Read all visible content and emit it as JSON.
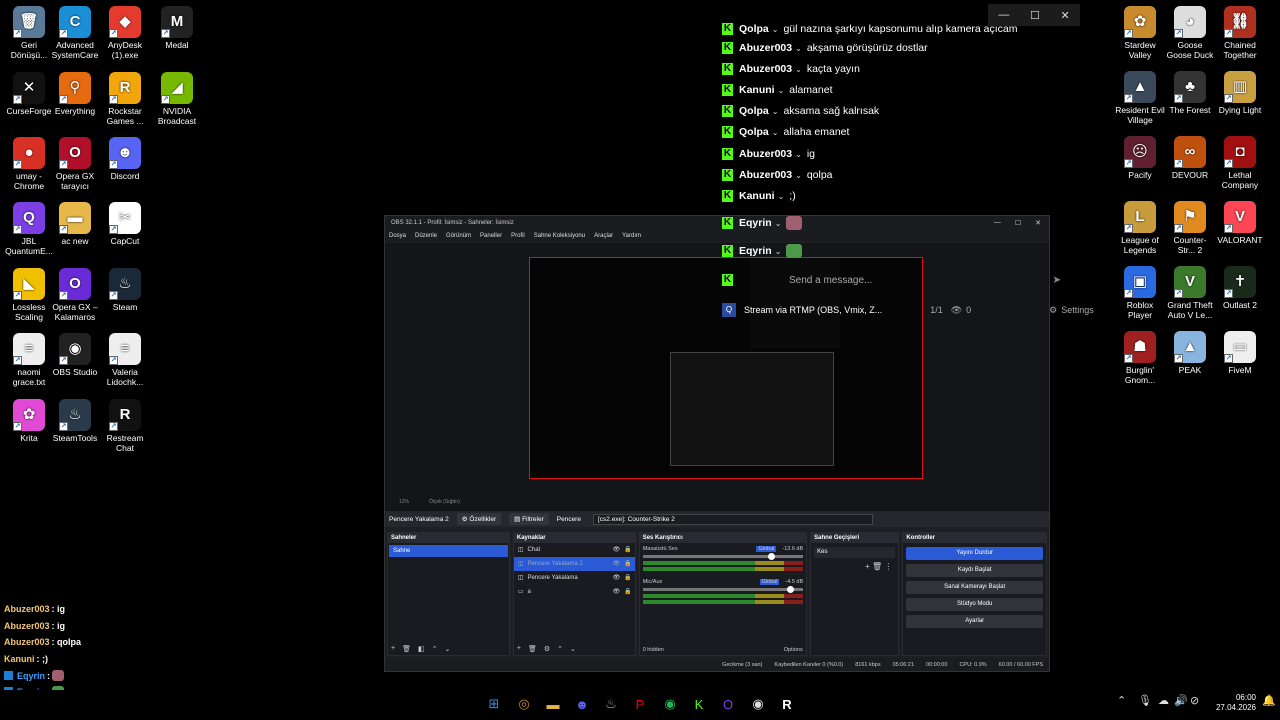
{
  "desktop_left": [
    {
      "label": "Geri Dönüşü...",
      "icon": "recycle-bin-icon",
      "glyph": "🗑",
      "color": "#5a7a9a"
    },
    {
      "label": "Advanced SystemCare",
      "icon": "systemcare-icon",
      "glyph": "C",
      "color": "#1a8fd6"
    },
    {
      "label": "AnyDesk (1).exe",
      "icon": "anydesk-icon",
      "glyph": "◆",
      "color": "#e33b2e"
    },
    {
      "label": "Medal",
      "icon": "medal-icon",
      "glyph": "M",
      "color": "#222"
    },
    {
      "label": "CurseForge",
      "icon": "curseforge-icon",
      "glyph": "✕",
      "color": "#111"
    },
    {
      "label": "Everything",
      "icon": "everything-icon",
      "glyph": "⚲",
      "color": "#e66b10"
    },
    {
      "label": "Rockstar Games ...",
      "icon": "rockstar-icon",
      "glyph": "R",
      "color": "#f2a60c"
    },
    {
      "label": "NVIDIA Broadcast",
      "icon": "nvidia-icon",
      "glyph": "◢",
      "color": "#76b900"
    },
    {
      "label": "umay - Chrome",
      "icon": "chrome-icon",
      "glyph": "●",
      "color": "#d93025"
    },
    {
      "label": "Opera GX tarayıcı",
      "icon": "opera-gx-icon",
      "glyph": "O",
      "color": "#b0102a"
    },
    {
      "label": "Discord",
      "icon": "discord-icon",
      "glyph": "☻",
      "color": "#5865f2"
    },
    {
      "label": "JBL QuantumE...",
      "icon": "jbl-icon",
      "glyph": "Q",
      "color": "#7b3fe4"
    },
    {
      "label": "ac new",
      "icon": "folder-icon",
      "glyph": "▬",
      "color": "#e6b84a"
    },
    {
      "label": "CapCut",
      "icon": "capcut-icon",
      "glyph": "✂",
      "color": "#fff"
    },
    {
      "label": "Lossless Scaling",
      "icon": "lossless-icon",
      "glyph": "◣",
      "color": "#f0c000"
    },
    {
      "label": "Opera GX – Kalamaros",
      "icon": "opera-gx-icon",
      "glyph": "O",
      "color": "#6a2ad6"
    },
    {
      "label": "Steam",
      "icon": "steam-icon",
      "glyph": "♨",
      "color": "#1b2838"
    },
    {
      "label": "naomi grace.txt",
      "icon": "text-file-icon",
      "glyph": "≡",
      "color": "#eee"
    },
    {
      "label": "OBS Studio",
      "icon": "obs-icon",
      "glyph": "◉",
      "color": "#222"
    },
    {
      "label": "Valeria Lidochk...",
      "icon": "text-file-icon",
      "glyph": "≡",
      "color": "#eee"
    },
    {
      "label": "Krita",
      "icon": "krita-icon",
      "glyph": "✿",
      "color": "#e24ad6"
    },
    {
      "label": "SteamTools",
      "icon": "steamtools-icon",
      "glyph": "♨",
      "color": "#2a3a4a"
    },
    {
      "label": "Restream Chat",
      "icon": "restream-icon",
      "glyph": "R",
      "color": "#111"
    }
  ],
  "desktop_right": [
    {
      "label": "Stardew Valley",
      "icon": "stardew-icon",
      "glyph": "✿",
      "color": "#c78a2c"
    },
    {
      "label": "Goose Goose Duck",
      "icon": "goose-icon",
      "glyph": "◕",
      "color": "#ddd"
    },
    {
      "label": "Chained Together",
      "icon": "chained-icon",
      "glyph": "⛓",
      "color": "#b03020"
    },
    {
      "label": "Resident Evil Village",
      "icon": "re-village-icon",
      "glyph": "▲",
      "color": "#3a4a5a"
    },
    {
      "label": "The Forest",
      "icon": "forest-icon",
      "glyph": "♣",
      "color": "#333"
    },
    {
      "label": "Dying Light",
      "icon": "dying-light-icon",
      "glyph": "▥",
      "color": "#c8a040"
    },
    {
      "label": "Pacify",
      "icon": "pacify-icon",
      "glyph": "☹",
      "color": "#602030"
    },
    {
      "label": "DEVOUR",
      "icon": "devour-icon",
      "glyph": "∞",
      "color": "#c05010"
    },
    {
      "label": "Lethal Company",
      "icon": "lethal-icon",
      "glyph": "◘",
      "color": "#a01010"
    },
    {
      "label": "League of Legends",
      "icon": "lol-icon",
      "glyph": "L",
      "color": "#c89b3c"
    },
    {
      "label": "Counter-Str... 2",
      "icon": "cs2-icon",
      "glyph": "⚑",
      "color": "#e08a20"
    },
    {
      "label": "VALORANT",
      "icon": "valorant-icon",
      "glyph": "V",
      "color": "#ff4655"
    },
    {
      "label": "Roblox Player",
      "icon": "roblox-icon",
      "glyph": "▣",
      "color": "#2a6ae0"
    },
    {
      "label": "Grand Theft Auto V Le...",
      "icon": "gta-icon",
      "glyph": "V",
      "color": "#3a7a2a"
    },
    {
      "label": "Outlast 2",
      "icon": "outlast-icon",
      "glyph": "✝",
      "color": "#1a2a1a"
    },
    {
      "label": "Burglin' Gnom...",
      "icon": "burglin-icon",
      "glyph": "☗",
      "color": "#a02020"
    },
    {
      "label": "PEAK",
      "icon": "peak-icon",
      "glyph": "▲",
      "color": "#8ab4e0"
    },
    {
      "label": "FiveM",
      "icon": "text-file-icon",
      "glyph": "▭",
      "color": "#eee"
    }
  ],
  "chat": [
    {
      "user": "Qolpa",
      "msg": "gül nazına şarkıyı kapsonumu alıp kamera açıcam",
      "emote": ""
    },
    {
      "user": "Abuzer003",
      "msg": "akşama görüşürüz dostlar",
      "emote": ""
    },
    {
      "user": "Abuzer003",
      "msg": "kaçta yayın",
      "emote": ""
    },
    {
      "user": "Kanuni",
      "msg": "alamanet",
      "emote": ""
    },
    {
      "user": "Qolpa",
      "msg": "aksama sağ kalrısak",
      "emote": ""
    },
    {
      "user": "Qolpa",
      "msg": "allaha emanet",
      "emote": ""
    },
    {
      "user": "Abuzer003",
      "msg": "ig",
      "emote": ""
    },
    {
      "user": "Abuzer003",
      "msg": "qolpa",
      "emote": ""
    },
    {
      "user": "Kanuni",
      "msg": ";)",
      "emote": ""
    },
    {
      "user": "Eqyrin",
      "msg": "",
      "emote": "#a06070"
    },
    {
      "user": "Eqyrin",
      "msg": "",
      "emote": "#4a9a4a"
    }
  ],
  "chat_input": {
    "placeholder": "Send a message..."
  },
  "stream_bar": {
    "label": "Stream via RTMP (OBS, Vmix, Z...",
    "page": "1/1",
    "viewers": "0",
    "settings": "Settings"
  },
  "obs": {
    "title": "OBS 32.1.1 - Profil: İsimsiz - Sahneler: İsimsiz",
    "menu": [
      "Dosya",
      "Düzenle",
      "Görünüm",
      "Paneller",
      "Profil",
      "Sahne Koleksiyonu",
      "Araçlar",
      "Yardım"
    ],
    "zoom": "12%",
    "zoom_mode": "Ölçek (Sığdır)",
    "source_name": "Pencere Yakalama 2",
    "btn_props": "Özellikler",
    "btn_filters": "Filtreler",
    "window_label": "Pencere",
    "window_value": "[cs2.exe]: Counter-Strike 2",
    "docks": {
      "scenes": "Sahneler",
      "sources": "Kaynaklar",
      "mixer": "Ses Karıştırıcı",
      "transitions": "Sahne Geçişleri",
      "controls": "Kontroller"
    },
    "scenes": [
      "Sahne"
    ],
    "sources": [
      {
        "name": "Chat",
        "active": false
      },
      {
        "name": "Pencere Yakalama 2",
        "active": true
      },
      {
        "name": "Pencere Yakalama",
        "active": false
      },
      {
        "name": "a",
        "active": false
      }
    ],
    "mixer": [
      {
        "name": "Masaüstü Ses",
        "tag": "Global",
        "db": "-13.6 dB",
        "level": 0.78
      },
      {
        "name": "Mic/Aux",
        "tag": "Global",
        "db": "-4.5 dB",
        "level": 0.9
      }
    ],
    "mixer_hidden": "0 hidden",
    "mixer_options": "Options",
    "transition": "Kes",
    "controls": [
      "Yayını Durdur",
      "Kaydı Başlat",
      "Sanal Kamerayı Başlat",
      "Stüdyo Modu",
      "Ayarlar"
    ],
    "status": {
      "delay": "Gecikme (3 san)",
      "dropped": "Kaybedilen Kareler 0 (%0.0)",
      "bitrate": "8161 kbps",
      "live_time": "05:06:21",
      "rec_time": "00:00:00",
      "cpu": "CPU: 0.9%",
      "fps": "60.00 / 60.00 FPS"
    }
  },
  "overlay_chat": [
    {
      "user": "Abuzer003",
      "msg": ": ig"
    },
    {
      "user": "Abuzer003",
      "msg": ": ig"
    },
    {
      "user": "Abuzer003",
      "msg": ": qolpa"
    },
    {
      "user": "Kanuni",
      "msg": ": ;)"
    },
    {
      "user": "Eqyrin",
      "msg": ":"
    },
    {
      "user": "Eqyrin",
      "msg": ":"
    }
  ],
  "taskbar": {
    "clock_time": "06:00",
    "clock_date": "27.04.2026"
  }
}
